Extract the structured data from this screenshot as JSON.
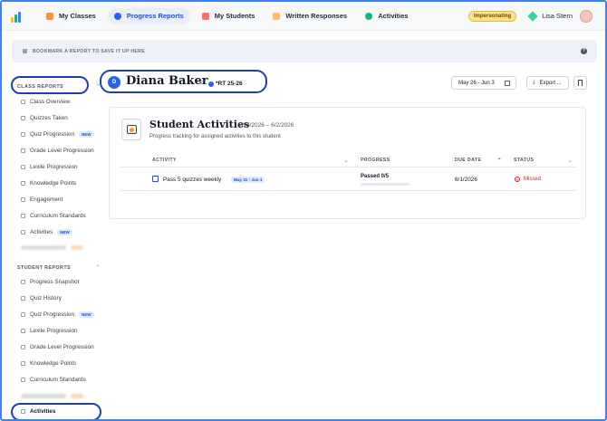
{
  "nav": {
    "items": [
      {
        "label": "My Classes",
        "icon": "classes-icon",
        "color": "#f97316"
      },
      {
        "label": "Progress Reports",
        "icon": "reports-icon",
        "color": "#2563eb",
        "active": true
      },
      {
        "label": "My Students",
        "icon": "students-icon",
        "color": "#ef4444"
      },
      {
        "label": "Written Responses",
        "icon": "responses-icon",
        "color": "#f97316"
      },
      {
        "label": "Activities",
        "icon": "activities-icon",
        "color": "#10b981"
      }
    ],
    "impersonating": "Impersonating",
    "user_name": "Lisa Stern"
  },
  "bookmark_bar": {
    "text": "BOOKMARK A REPORT TO SAVE IT UP HERE"
  },
  "sidebar": {
    "class_reports_heading": "CLASS REPORTS",
    "class_reports": [
      {
        "label": "Class Overview"
      },
      {
        "label": "Quizzes Taken"
      },
      {
        "label": "Quiz Progression",
        "badge": "NEW"
      },
      {
        "label": "Grade Level Progression"
      },
      {
        "label": "Lexile Progression"
      },
      {
        "label": "Knowledge Points"
      },
      {
        "label": "Engagement"
      },
      {
        "label": "Curriculum Standards"
      },
      {
        "label": "Activities",
        "badge": "NEW"
      }
    ],
    "student_reports_heading": "STUDENT REPORTS",
    "student_reports": [
      {
        "label": "Progress Snapshot"
      },
      {
        "label": "Quiz History"
      },
      {
        "label": "Quiz Progression",
        "badge": "NEW"
      },
      {
        "label": "Lexile Progression"
      },
      {
        "label": "Grade Level Progression"
      },
      {
        "label": "Knowledge Points"
      },
      {
        "label": "Curriculum Standards"
      },
      {
        "label": "Activities",
        "active": true
      }
    ]
  },
  "header": {
    "student_initial": "D",
    "student_name": "Diana Baker",
    "of_label": "of",
    "class_name": "*RT 25-26",
    "date_range": "May 26 - Jun 3",
    "export_label": "Export ..."
  },
  "card": {
    "title": "Student Activities",
    "range": "·   5/26/2026 – 6/2/2026",
    "subtitle": "Progress tracking for assigned activities to this student",
    "columns": {
      "activity": "ACTIVITY",
      "progress": "PROGRESS",
      "due_date": "DUE DATE",
      "status": "STATUS"
    },
    "rows": [
      {
        "activity": "Pass 5 quizzes weekly",
        "range_badge": "May 31 - Jun 1",
        "progress_label": "Passed 0/5",
        "progress_fraction": 0,
        "due_date": "6/1/2026",
        "status": "Missed"
      }
    ]
  }
}
